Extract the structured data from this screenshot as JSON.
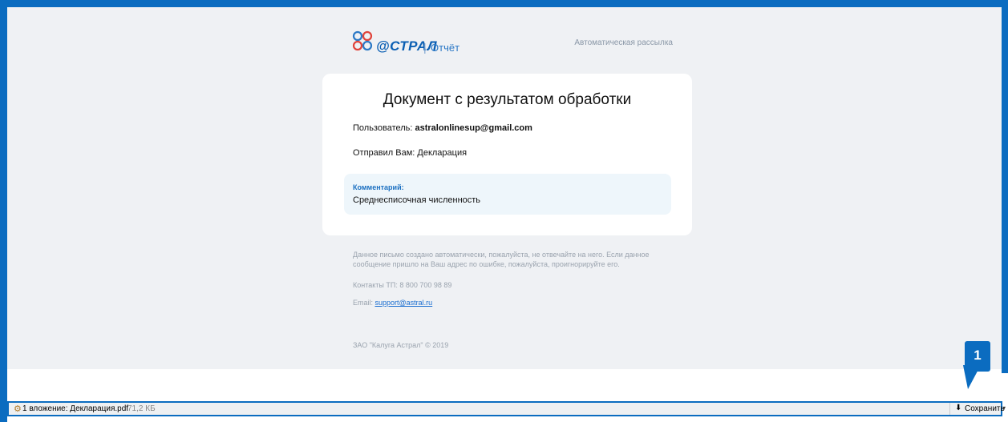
{
  "header": {
    "logo_text": "@СТРАЛ",
    "logo_separator": "|",
    "logo_subtitle": "Отчёт",
    "auto_mailing": "Автоматическая рассылка"
  },
  "card": {
    "title": "Документ с результатом обработки",
    "user_label": "Пользователь: ",
    "user_email": "astralonlinesup@gmail.com",
    "sender_line": "Отправил Вам: Декларация",
    "comment_label": "Комментарий:",
    "comment_text": "Среднесписочная численность"
  },
  "footer": {
    "notice": "Данное письмо создано автоматически, пожалуйста, не отвечайте на него. Если данное сообщение пришло на Ваш адрес по ошибке, пожалуйста, проигнорируйте его.",
    "contacts": "Контакты ТП: 8 800 700 98 89",
    "email_label": "Email: ",
    "email_link": "support@astral.ru",
    "copyright": "ЗАО \"Калуга Астрал\" © 2019"
  },
  "callout": {
    "number": "1"
  },
  "attachment_bar": {
    "label": "1 вложение: Декларация.pdf",
    "size": "71,2 КБ",
    "save_label": "Сохранить",
    "icons": {
      "attachment": "paperclip-icon",
      "save": "download-icon",
      "dropdown": "chevron-down-icon"
    }
  },
  "colors": {
    "accent": "#0b6cc0",
    "page_bg": "#eff1f4",
    "comment_bg": "#eef6fb",
    "link": "#1b6fd1"
  }
}
